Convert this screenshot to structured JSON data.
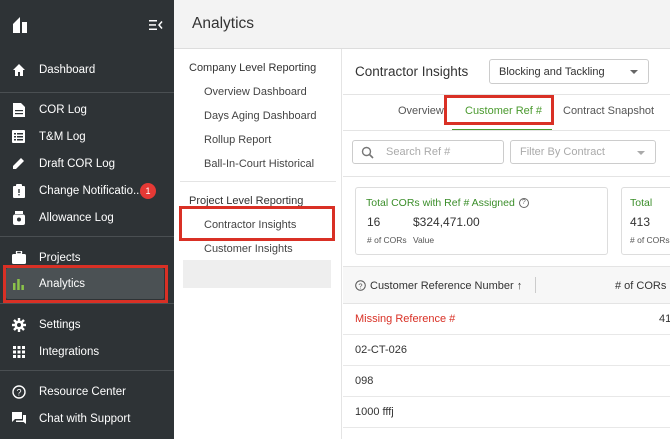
{
  "sidebar": {
    "items": [
      {
        "label": "Dashboard",
        "icon": "home-icon"
      },
      {
        "label": "COR Log",
        "icon": "document-icon"
      },
      {
        "label": "T&M Log",
        "icon": "list-icon"
      },
      {
        "label": "Draft COR Log",
        "icon": "pencil-icon"
      },
      {
        "label": "Change Notificatio...",
        "icon": "clipboard-icon",
        "badge": "1"
      },
      {
        "label": "Allowance Log",
        "icon": "jar-icon"
      },
      {
        "label": "Projects",
        "icon": "briefcase-icon"
      },
      {
        "label": "Analytics",
        "icon": "bar-chart-icon",
        "active": true
      },
      {
        "label": "Settings",
        "icon": "gear-icon"
      },
      {
        "label": "Integrations",
        "icon": "grid-icon"
      },
      {
        "label": "Resource Center",
        "icon": "help-circle-icon"
      },
      {
        "label": "Chat with Support",
        "icon": "chat-icon"
      }
    ]
  },
  "header": {
    "title": "Analytics"
  },
  "subnav": {
    "company_heading": "Company Level Reporting",
    "company_items": [
      "Overview Dashboard",
      "Days Aging Dashboard",
      "Rollup Report",
      "Ball-In-Court Historical"
    ],
    "project_heading": "Project Level Reporting",
    "project_items": [
      "Contractor Insights",
      "Customer Insights"
    ]
  },
  "content": {
    "title": "Contractor Insights",
    "dropdown_value": "Blocking and Tackling",
    "tabs": [
      "Overview",
      "Customer Ref #",
      "Contract Snapshot"
    ],
    "search_placeholder": "Search Ref #",
    "filter_placeholder": "Filter By Contract",
    "cards": [
      {
        "title": "Total CORs with Ref # Assigned",
        "count": "16",
        "count_label": "# of CORs",
        "value": "$324,471.00",
        "value_label": "Value"
      },
      {
        "title": "Total",
        "count": "413",
        "count_label": "# of CORs"
      }
    ],
    "table": {
      "col1": "Customer Reference Number",
      "col2": "# of CORs",
      "rows": [
        {
          "ref": "Missing Reference #",
          "count": "41"
        },
        {
          "ref": "02-CT-026",
          "count": ""
        },
        {
          "ref": "098",
          "count": ""
        },
        {
          "ref": "1000 fffj",
          "count": ""
        }
      ]
    }
  },
  "colors": {
    "sidebar_bg": "#2e3336",
    "accent_green": "#4a9a2e",
    "highlight_red": "#d93025"
  }
}
